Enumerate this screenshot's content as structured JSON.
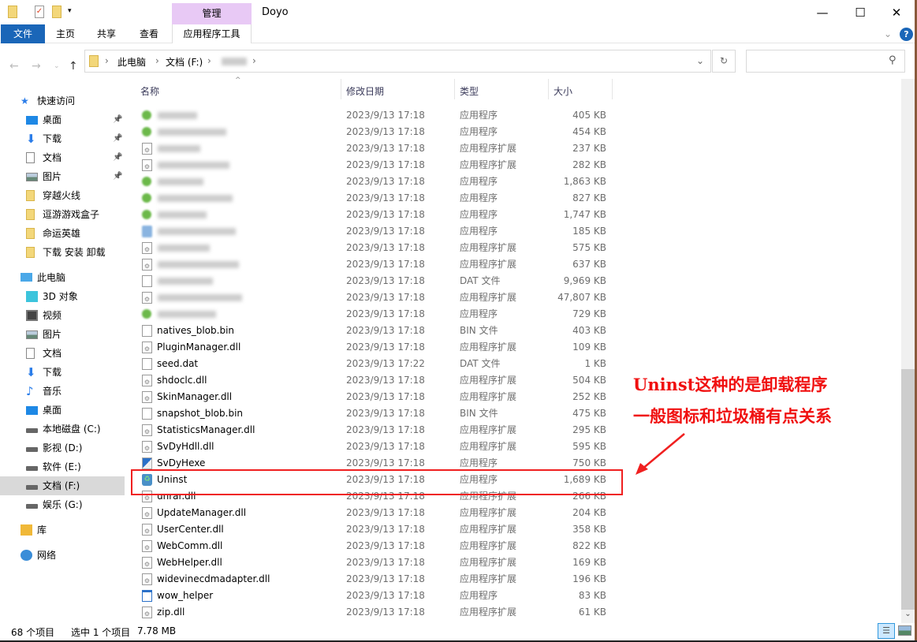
{
  "window": {
    "title": "Doyo",
    "context_tab": "管理",
    "minimize": "—",
    "maximize": "☐",
    "close": "✕"
  },
  "ribbon": {
    "tabs": [
      "文件",
      "主页",
      "共享",
      "查看"
    ],
    "app_tools": "应用程序工具"
  },
  "address": {
    "crumbs": [
      "此电脑",
      "文档 (F:)"
    ],
    "current_blurred": true
  },
  "sidebar": {
    "quick_access": "快速访问",
    "quick_items": [
      {
        "label": "桌面",
        "icon": "desktop-icon",
        "pinned": true
      },
      {
        "label": "下载",
        "icon": "download-icon",
        "pinned": true
      },
      {
        "label": "文档",
        "icon": "document-icon",
        "pinned": true
      },
      {
        "label": "图片",
        "icon": "picture-icon",
        "pinned": true
      },
      {
        "label": "穿越火线",
        "icon": "folder-icon"
      },
      {
        "label": "逗游游戏盒子",
        "icon": "folder-icon"
      },
      {
        "label": "命运英雄",
        "icon": "folder-icon"
      },
      {
        "label": "下载 安装 卸载",
        "icon": "folder-icon"
      }
    ],
    "this_pc": "此电脑",
    "pc_items": [
      {
        "label": "3D 对象",
        "icon": "3d-objects-icon"
      },
      {
        "label": "视频",
        "icon": "video-icon"
      },
      {
        "label": "图片",
        "icon": "picture-icon"
      },
      {
        "label": "文档",
        "icon": "document-icon"
      },
      {
        "label": "下载",
        "icon": "download-icon"
      },
      {
        "label": "音乐",
        "icon": "music-icon"
      },
      {
        "label": "桌面",
        "icon": "desktop-icon"
      },
      {
        "label": "本地磁盘 (C:)",
        "icon": "drive-icon"
      },
      {
        "label": "影视 (D:)",
        "icon": "drive-icon"
      },
      {
        "label": "软件 (E:)",
        "icon": "drive-icon"
      },
      {
        "label": "文档 (F:)",
        "icon": "drive-icon",
        "selected": true
      },
      {
        "label": "娱乐 (G:)",
        "icon": "drive-icon"
      }
    ],
    "library": "库",
    "network": "网络"
  },
  "columns": {
    "name": "名称",
    "date": "修改日期",
    "type": "类型",
    "size": "大小"
  },
  "files": [
    {
      "name": "",
      "icon": "exe-green",
      "date": "2023/9/13 17:18",
      "type": "应用程序",
      "size": "405 KB"
    },
    {
      "name": "",
      "icon": "exe-green",
      "date": "2023/9/13 17:18",
      "type": "应用程序",
      "size": "454 KB"
    },
    {
      "name": "",
      "icon": "dll",
      "date": "2023/9/13 17:18",
      "type": "应用程序扩展",
      "size": "237 KB"
    },
    {
      "name": "",
      "icon": "dll",
      "date": "2023/9/13 17:18",
      "type": "应用程序扩展",
      "size": "282 KB"
    },
    {
      "name": "",
      "icon": "exe-green",
      "date": "2023/9/13 17:18",
      "type": "应用程序",
      "size": "1,863 KB"
    },
    {
      "name": "",
      "icon": "exe-green",
      "date": "2023/9/13 17:18",
      "type": "应用程序",
      "size": "827 KB"
    },
    {
      "name": "",
      "icon": "exe-green",
      "date": "2023/9/13 17:18",
      "type": "应用程序",
      "size": "1,747 KB"
    },
    {
      "name": "",
      "icon": "exe-blue",
      "date": "2023/9/13 17:18",
      "type": "应用程序",
      "size": "185 KB"
    },
    {
      "name": "",
      "icon": "dll",
      "date": "2023/9/13 17:18",
      "type": "应用程序扩展",
      "size": "575 KB"
    },
    {
      "name": "",
      "icon": "dll",
      "date": "2023/9/13 17:18",
      "type": "应用程序扩展",
      "size": "637 KB"
    },
    {
      "name": "",
      "icon": "file",
      "date": "2023/9/13 17:18",
      "type": "DAT 文件",
      "size": "9,969 KB"
    },
    {
      "name": "",
      "icon": "dll",
      "date": "2023/9/13 17:18",
      "type": "应用程序扩展",
      "size": "47,807 KB"
    },
    {
      "name": "",
      "icon": "exe-green",
      "date": "2023/9/13 17:18",
      "type": "应用程序",
      "size": "729 KB"
    },
    {
      "name": "natives_blob.bin",
      "icon": "file",
      "date": "2023/9/13 17:18",
      "type": "BIN 文件",
      "size": "403 KB"
    },
    {
      "name": "PluginManager.dll",
      "icon": "dll",
      "date": "2023/9/13 17:18",
      "type": "应用程序扩展",
      "size": "109 KB"
    },
    {
      "name": "seed.dat",
      "icon": "file",
      "date": "2023/9/13 17:22",
      "type": "DAT 文件",
      "size": "1 KB"
    },
    {
      "name": "shdoclc.dll",
      "icon": "dll",
      "date": "2023/9/13 17:18",
      "type": "应用程序扩展",
      "size": "504 KB"
    },
    {
      "name": "SkinManager.dll",
      "icon": "dll",
      "date": "2023/9/13 17:18",
      "type": "应用程序扩展",
      "size": "252 KB"
    },
    {
      "name": "snapshot_blob.bin",
      "icon": "file",
      "date": "2023/9/13 17:18",
      "type": "BIN 文件",
      "size": "475 KB"
    },
    {
      "name": "StatisticsManager.dll",
      "icon": "dll",
      "date": "2023/9/13 17:18",
      "type": "应用程序扩展",
      "size": "295 KB"
    },
    {
      "name": "SvDyHdll.dll",
      "icon": "dll",
      "date": "2023/9/13 17:18",
      "type": "应用程序扩展",
      "size": "595 KB"
    },
    {
      "name": "SvDyHexe",
      "icon": "exe-svdy",
      "date": "2023/9/13 17:18",
      "type": "应用程序",
      "size": "750 KB"
    },
    {
      "name": "Uninst",
      "icon": "recycle",
      "date": "2023/9/13 17:18",
      "type": "应用程序",
      "size": "1,689 KB"
    },
    {
      "name": "unrar.dll",
      "icon": "dll",
      "date": "2023/9/13 17:18",
      "type": "应用程序扩展",
      "size": "266 KB"
    },
    {
      "name": "UpdateManager.dll",
      "icon": "dll",
      "date": "2023/9/13 17:18",
      "type": "应用程序扩展",
      "size": "204 KB"
    },
    {
      "name": "UserCenter.dll",
      "icon": "dll",
      "date": "2023/9/13 17:18",
      "type": "应用程序扩展",
      "size": "358 KB"
    },
    {
      "name": "WebComm.dll",
      "icon": "dll",
      "date": "2023/9/13 17:18",
      "type": "应用程序扩展",
      "size": "822 KB"
    },
    {
      "name": "WebHelper.dll",
      "icon": "dll",
      "date": "2023/9/13 17:18",
      "type": "应用程序扩展",
      "size": "169 KB"
    },
    {
      "name": "widevinecdmadapter.dll",
      "icon": "dll",
      "date": "2023/9/13 17:18",
      "type": "应用程序扩展",
      "size": "196 KB"
    },
    {
      "name": "wow_helper",
      "icon": "exe-window",
      "date": "2023/9/13 17:18",
      "type": "应用程序",
      "size": "83 KB"
    },
    {
      "name": "zip.dll",
      "icon": "dll",
      "date": "2023/9/13 17:18",
      "type": "应用程序扩展",
      "size": "61 KB"
    }
  ],
  "status": {
    "count": "68 个项目",
    "selected": "选中 1 个项目",
    "size": "7.78 MB"
  },
  "annotation": {
    "line1": "Uninst这种的是卸载程序",
    "line2": "一般图标和垃圾桶有点关系",
    "color": "#f01010"
  },
  "colors": {
    "accent": "#1a66b8",
    "context_tab": "#e8c9f5",
    "selection": "#d9d9d9"
  }
}
